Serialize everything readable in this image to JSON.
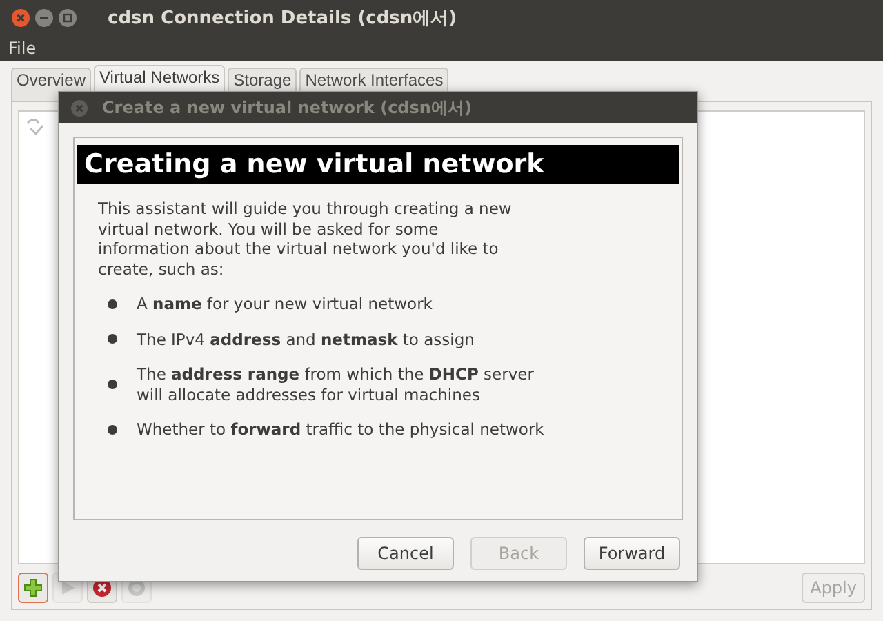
{
  "window": {
    "title": "cdsn Connection Details (cdsn에서)"
  },
  "menu": [
    "File"
  ],
  "tabs": [
    {
      "label": "Overview",
      "selected": false
    },
    {
      "label": "Virtual Networks",
      "selected": true
    },
    {
      "label": "Storage",
      "selected": false
    },
    {
      "label": "Network Interfaces",
      "selected": false
    }
  ],
  "toolbar": [
    {
      "kind": "add",
      "disabled": false
    },
    {
      "kind": "start",
      "disabled": true
    },
    {
      "kind": "delete",
      "disabled": false
    },
    {
      "kind": "stop",
      "disabled": true
    }
  ],
  "apply_button": {
    "label": "Apply",
    "disabled": true
  },
  "dialog": {
    "title": "Create a new virtual network (cdsn에서)",
    "heading": "Creating a new virtual network",
    "intro": [
      "This assistant will guide you through creating a new",
      "virtual network. You will be asked for some",
      "information about the virtual network you'd like to",
      "create, such as:"
    ],
    "items": [
      {
        "lines": [
          "A **name** for your new virtual network"
        ]
      },
      {
        "lines": [
          "The IPv4 **address** and **netmask** to assign"
        ]
      },
      {
        "lines": [
          "The **address range** from which the **DHCP** server",
          "will allocate addresses for virtual machines"
        ]
      },
      {
        "lines": [
          "Whether to **forward** traffic to the physical network"
        ]
      }
    ],
    "buttons": [
      {
        "label": "Cancel",
        "disabled": false
      },
      {
        "label": "Back",
        "disabled": true
      },
      {
        "label": "Forward",
        "disabled": false
      }
    ]
  }
}
